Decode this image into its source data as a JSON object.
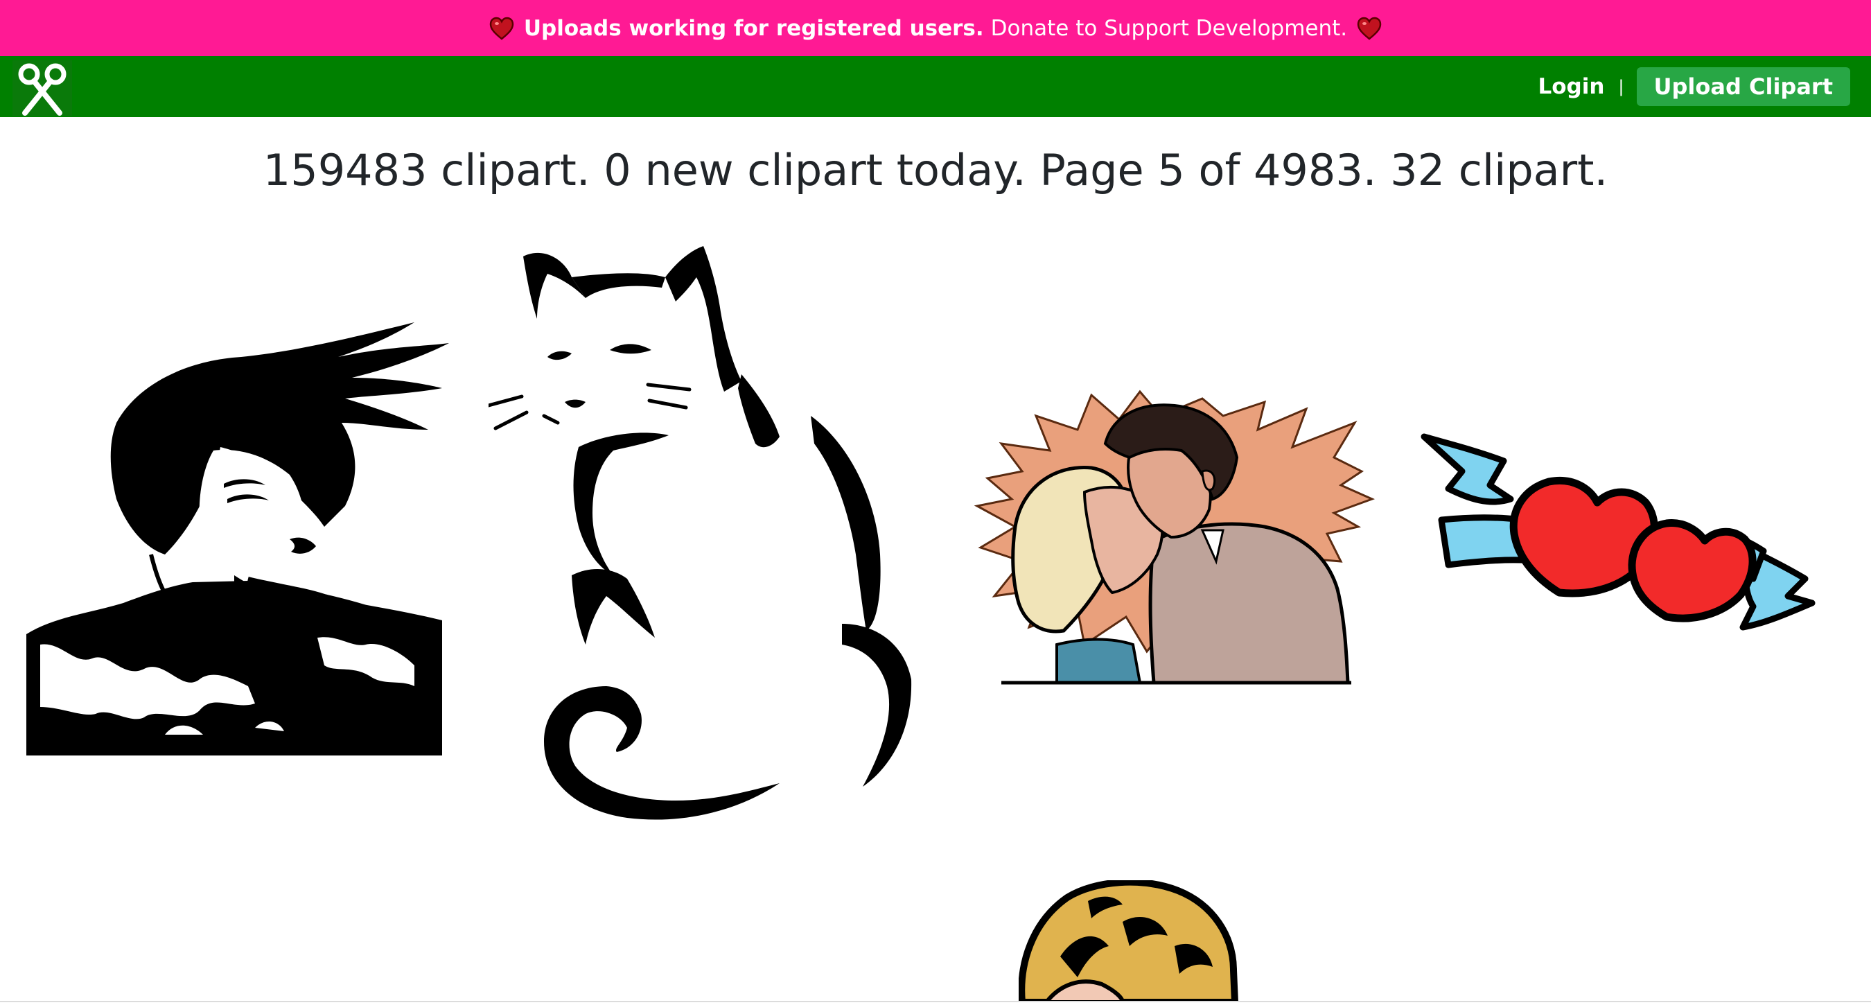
{
  "banner": {
    "strong": "Uploads working for registered users.",
    "link": "Donate to Support Development.",
    "color": "#ff1a94"
  },
  "nav": {
    "color": "#008000",
    "logo_icon": "scissors-icon",
    "login": "Login",
    "separator": "|",
    "upload": "Upload Clipart"
  },
  "stats": "159483 clipart. 0 new clipart today. Page 5 of 4983. 32 clipart.",
  "gallery": {
    "items": [
      {
        "subject": "woman-hair-wind"
      },
      {
        "subject": "cat-silhouette"
      },
      {
        "subject": "couple-kissing"
      },
      {
        "subject": "two-hearts-ribbon"
      },
      {
        "subject": "blonde-hair-partial"
      }
    ]
  }
}
